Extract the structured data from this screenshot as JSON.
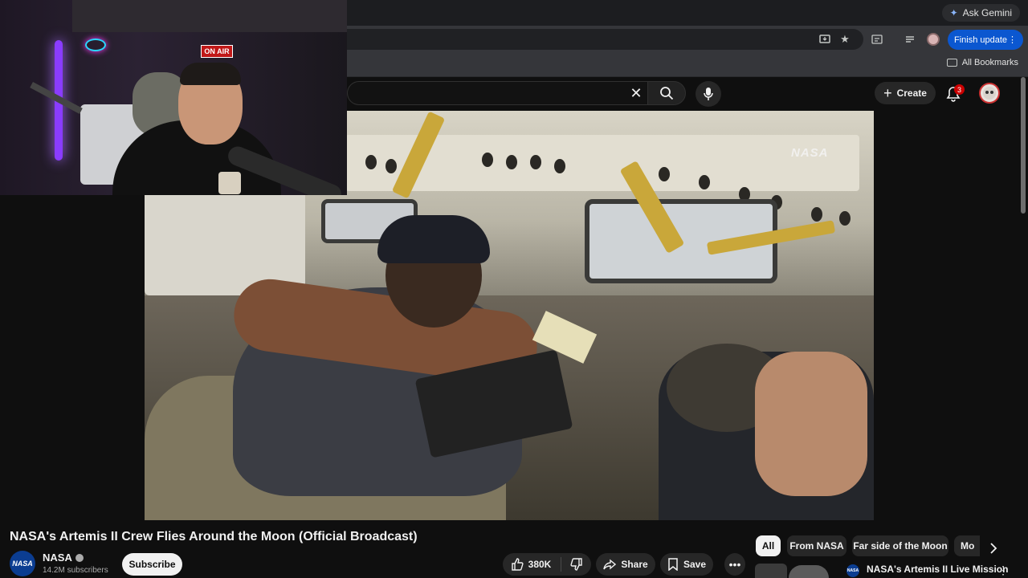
{
  "browser": {
    "ask_gemini": "Ask Gemini",
    "finish_update": "Finish update",
    "all_bookmarks": "All Bookmarks"
  },
  "header": {
    "create_label": "Create",
    "notification_count": "3"
  },
  "webcam": {
    "on_air": "ON AIR"
  },
  "video": {
    "watermark": "NASA",
    "title": "NASA's Artemis II Crew Flies Around the Moon (Official Broadcast)"
  },
  "channel": {
    "avatar_text": "NASA",
    "name": "NASA",
    "subscribers": "14.2M subscribers",
    "subscribe_label": "Subscribe"
  },
  "actions": {
    "likes": "380K",
    "share_label": "Share",
    "save_label": "Save"
  },
  "chips": [
    {
      "label": "All",
      "active": true
    },
    {
      "label": "From NASA",
      "active": false
    },
    {
      "label": "Far side of the Moon",
      "active": false
    },
    {
      "label": "Mo",
      "active": false
    }
  ],
  "recommendation": {
    "channel_avatar_text": "NASA",
    "title": "NASA's Artemis II Live Mission"
  },
  "colors": {
    "background": "#0f0f0f",
    "surface": "#272727",
    "update_button": "#0b57d0",
    "badge": "#cc0000"
  }
}
